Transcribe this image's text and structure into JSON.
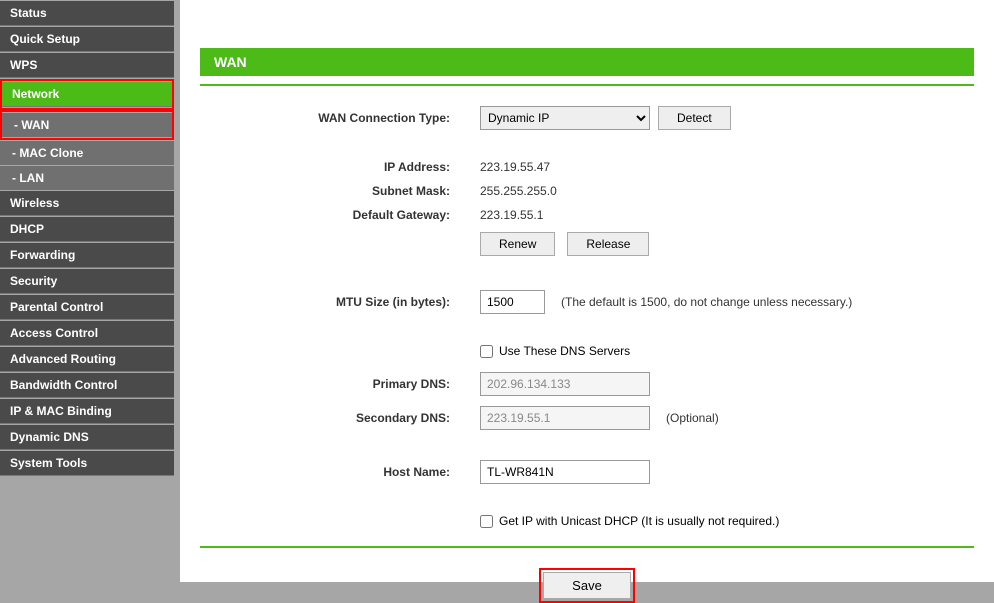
{
  "sidebar": {
    "items": [
      {
        "label": "Status",
        "type": "main"
      },
      {
        "label": "Quick Setup",
        "type": "main"
      },
      {
        "label": "WPS",
        "type": "main"
      },
      {
        "label": "Network",
        "type": "main",
        "active": true,
        "highlighted": true
      },
      {
        "label": "- WAN",
        "type": "sub",
        "highlighted": true
      },
      {
        "label": "- MAC Clone",
        "type": "sub"
      },
      {
        "label": "- LAN",
        "type": "sub"
      },
      {
        "label": "Wireless",
        "type": "main"
      },
      {
        "label": "DHCP",
        "type": "main"
      },
      {
        "label": "Forwarding",
        "type": "main"
      },
      {
        "label": "Security",
        "type": "main"
      },
      {
        "label": "Parental Control",
        "type": "main"
      },
      {
        "label": "Access Control",
        "type": "main"
      },
      {
        "label": "Advanced Routing",
        "type": "main"
      },
      {
        "label": "Bandwidth Control",
        "type": "main"
      },
      {
        "label": "IP & MAC Binding",
        "type": "main"
      },
      {
        "label": "Dynamic DNS",
        "type": "main"
      },
      {
        "label": "System Tools",
        "type": "main"
      }
    ]
  },
  "page": {
    "title": "WAN",
    "conn_type_label": "WAN Connection Type:",
    "conn_type_value": "Dynamic IP",
    "detect_btn": "Detect",
    "ip_label": "IP Address:",
    "ip_value": "223.19.55.47",
    "subnet_label": "Subnet Mask:",
    "subnet_value": "255.255.255.0",
    "gateway_label": "Default Gateway:",
    "gateway_value": "223.19.55.1",
    "renew_btn": "Renew",
    "release_btn": "Release",
    "mtu_label": "MTU Size (in bytes):",
    "mtu_value": "1500",
    "mtu_hint": "(The default is 1500, do not change unless necessary.)",
    "use_dns_label": "Use These DNS Servers",
    "primary_dns_label": "Primary DNS:",
    "primary_dns_value": "202.96.134.133",
    "secondary_dns_label": "Secondary DNS:",
    "secondary_dns_value": "223.19.55.1",
    "optional_hint": "(Optional)",
    "hostname_label": "Host Name:",
    "hostname_value": "TL-WR841N",
    "unicast_label": "Get IP with Unicast DHCP (It is usually not required.)",
    "save_btn": "Save"
  }
}
